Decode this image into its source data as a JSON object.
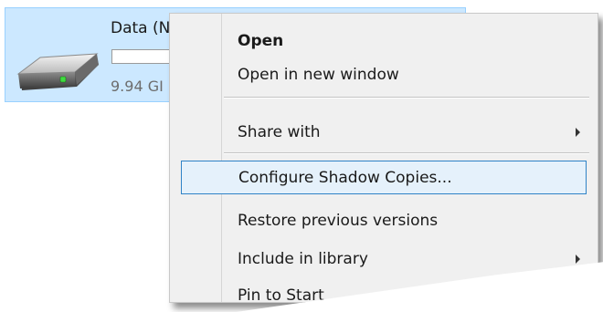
{
  "drive": {
    "name": "Data (N",
    "free_space_text": "9.94 GI",
    "usage_fraction": 0,
    "icon": "hard-drive-icon"
  },
  "context_menu": {
    "items": [
      {
        "label": "Open",
        "bold": true,
        "submenu": false
      },
      {
        "label": "Open in new window",
        "bold": false,
        "submenu": false
      },
      {
        "label": "Share with",
        "bold": false,
        "submenu": true
      },
      {
        "label": "Configure Shadow Copies...",
        "bold": false,
        "submenu": false,
        "highlighted": true
      },
      {
        "label": "Restore previous versions",
        "bold": false,
        "submenu": false
      },
      {
        "label": "Include in library",
        "bold": false,
        "submenu": true
      },
      {
        "label": "Pin to Start",
        "bold": false,
        "submenu": false
      }
    ]
  },
  "colors": {
    "selection_fill": "#cce8ff",
    "selection_border": "#99d1ff",
    "menu_background": "#f0f0f0",
    "menu_highlight_fill": "#e5f1fb",
    "menu_highlight_border": "#2f83c7"
  }
}
